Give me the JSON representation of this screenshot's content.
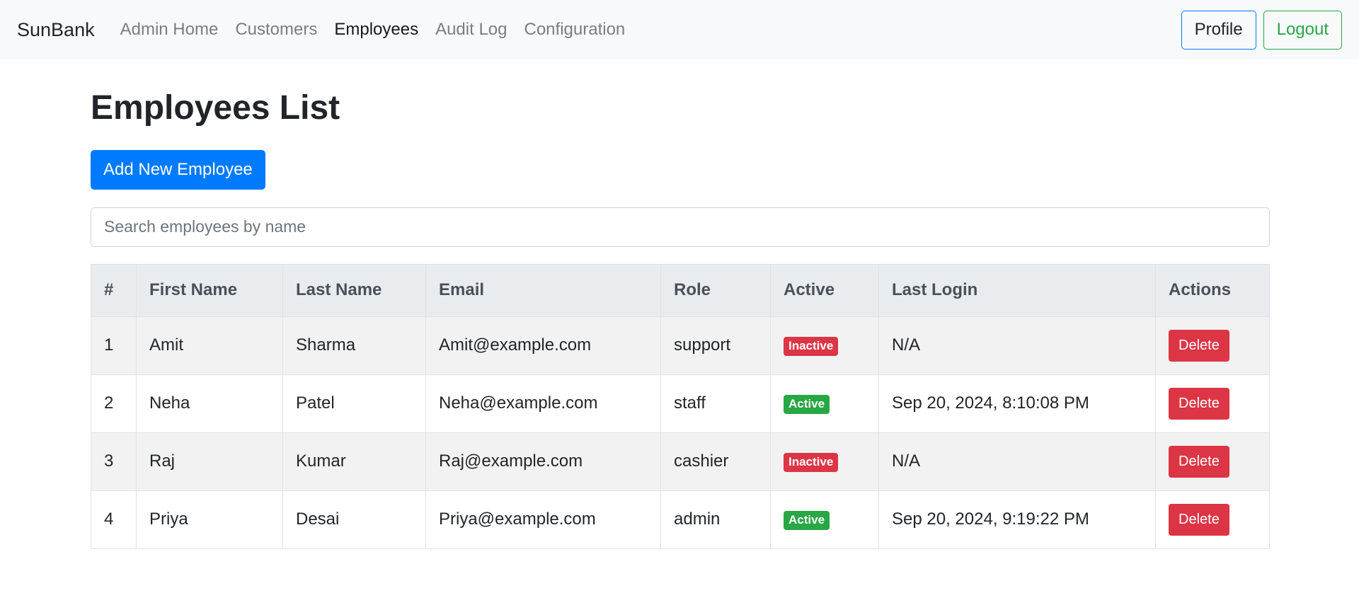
{
  "navbar": {
    "brand": "SunBank",
    "links": [
      {
        "label": "Admin Home",
        "active": false
      },
      {
        "label": "Customers",
        "active": false
      },
      {
        "label": "Employees",
        "active": true
      },
      {
        "label": "Audit Log",
        "active": false
      },
      {
        "label": "Configuration",
        "active": false
      }
    ],
    "profile_label": "Profile",
    "logout_label": "Logout"
  },
  "page": {
    "title": "Employees List",
    "add_button_label": "Add New Employee",
    "search_placeholder": "Search employees by name"
  },
  "table": {
    "headers": [
      "#",
      "First Name",
      "Last Name",
      "Email",
      "Role",
      "Active",
      "Last Login",
      "Actions"
    ],
    "delete_label": "Delete",
    "rows": [
      {
        "num": "1",
        "first": "Amit",
        "last": "Sharma",
        "email": "Amit@example.com",
        "role": "support",
        "active": "Inactive",
        "last_login": "N/A"
      },
      {
        "num": "2",
        "first": "Neha",
        "last": "Patel",
        "email": "Neha@example.com",
        "role": "staff",
        "active": "Active",
        "last_login": "Sep 20, 2024, 8:10:08 PM"
      },
      {
        "num": "3",
        "first": "Raj",
        "last": "Kumar",
        "email": "Raj@example.com",
        "role": "cashier",
        "active": "Inactive",
        "last_login": "N/A"
      },
      {
        "num": "4",
        "first": "Priya",
        "last": "Desai",
        "email": "Priya@example.com",
        "role": "admin",
        "active": "Active",
        "last_login": "Sep 20, 2024, 9:19:22 PM"
      }
    ]
  },
  "colors": {
    "primary": "#007bff",
    "success": "#28a745",
    "danger": "#dc3545",
    "navbar_bg": "#f8f9fa",
    "table_header_bg": "#e9ecef"
  }
}
